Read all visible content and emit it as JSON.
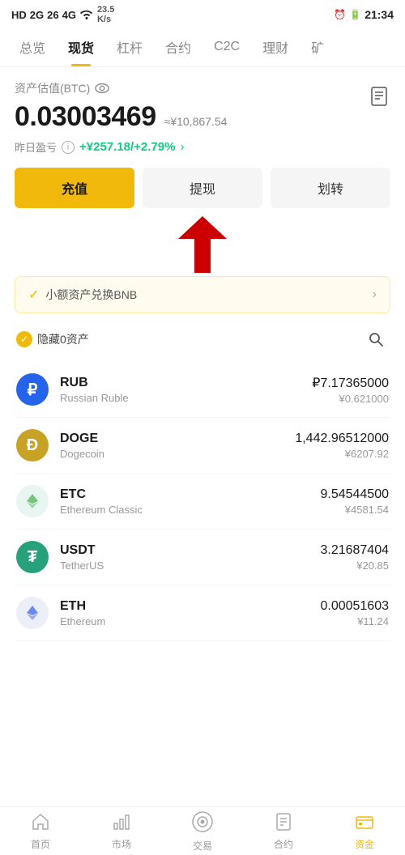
{
  "statusBar": {
    "left": "HD 2G 26 4G",
    "signal": "46",
    "speed": "23.5 K/s",
    "time": "21:34",
    "battery": "20"
  },
  "nav": {
    "items": [
      "总览",
      "现货",
      "杠杆",
      "合约",
      "C2C",
      "理财",
      "矿"
    ]
  },
  "activeNav": "现货",
  "asset": {
    "label": "资产估值(BTC)",
    "btcValue": "0.03003469",
    "cnyApprox": "≈¥10,867.54",
    "pnlLabel": "昨日盈亏",
    "pnlValue": "+¥257.18/+2.79%"
  },
  "buttons": {
    "deposit": "充值",
    "withdraw": "提现",
    "transfer": "划转"
  },
  "bnbBanner": {
    "text": "小额资产兑换BNB"
  },
  "filter": {
    "label": "隐藏0资产"
  },
  "coins": [
    {
      "symbol": "RUB",
      "name": "Russian Ruble",
      "amount": "₽7.17365000",
      "cny": "¥0.621000",
      "iconType": "rub",
      "iconChar": "₽"
    },
    {
      "symbol": "DOGE",
      "name": "Dogecoin",
      "amount": "1,442.96512000",
      "cny": "¥6207.92",
      "iconType": "doge",
      "iconChar": "Ð"
    },
    {
      "symbol": "ETC",
      "name": "Ethereum Classic",
      "amount": "9.54544500",
      "cny": "¥4581.54",
      "iconType": "etc",
      "iconChar": "◆"
    },
    {
      "symbol": "USDT",
      "name": "TetherUS",
      "amount": "3.21687404",
      "cny": "¥20.85",
      "iconType": "usdt",
      "iconChar": "₮"
    },
    {
      "symbol": "ETH",
      "name": "Ethereum",
      "amount": "0.00051603",
      "cny": "¥11.24",
      "iconType": "eth",
      "iconChar": "Ξ"
    }
  ],
  "bottomNav": {
    "items": [
      "首页",
      "市场",
      "交易",
      "合约",
      "资金"
    ]
  },
  "activeBottomNav": "资金"
}
